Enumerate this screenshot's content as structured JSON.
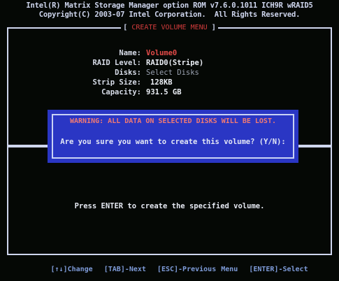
{
  "header": {
    "line1": "Intel(R) Matrix Storage Manager option ROM v7.6.0.1011 ICH9R wRAID5",
    "line2": "Copyright(C) 2003-07 Intel Corporation.  All Rights Reserved."
  },
  "menu": {
    "title": "CREATE VOLUME MENU"
  },
  "fields": [
    {
      "label": "Name:",
      "value": "Volume0"
    },
    {
      "label": "RAID Level:",
      "value": "RAID0(Stripe)"
    },
    {
      "label": "Disks:",
      "value": "Select Disks"
    },
    {
      "label": "Strip Size:",
      "value": "128KB"
    },
    {
      "label": "Capacity:",
      "value": "931.5 GB"
    }
  ],
  "dialog": {
    "warning": "WARNING: ALL DATA ON SELECTED DISKS WILL BE LOST.",
    "confirm": "Are you sure you want to create this volume? (Y/N):"
  },
  "help": "Press ENTER to create the specified volume.",
  "footer": {
    "change": "[↑↓]Change",
    "next": "[TAB]-Next",
    "prev": "[ESC]-Previous Menu",
    "select": "[ENTER]-Select"
  },
  "colors": {
    "background": "#050805",
    "dialog": "#2a36c4",
    "warning": "#f07a74",
    "title": "#d23c3c"
  }
}
